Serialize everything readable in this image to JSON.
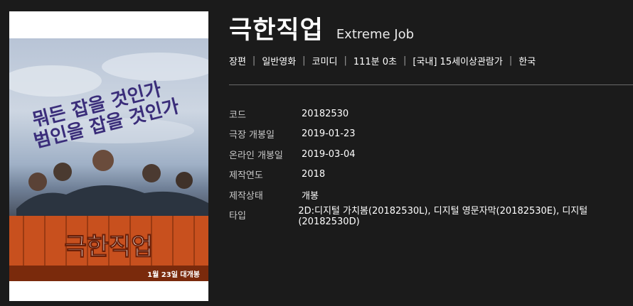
{
  "movie": {
    "title_ko": "극한직업",
    "title_en": "Extreme Job",
    "meta": [
      "장편",
      "일반영화",
      "코미디",
      "111분 0초",
      "[국내] 15세이상관람가",
      "한국"
    ],
    "details": [
      {
        "label": "코드",
        "value": "20182530"
      },
      {
        "label": "극장 개봉일",
        "value": "2019-01-23"
      },
      {
        "label": "온라인 개봉일",
        "value": "2019-03-04"
      },
      {
        "label": "제작연도",
        "value": "2018"
      },
      {
        "label": "제작상태",
        "value": "개봉"
      },
      {
        "label": "타입",
        "value": "2D:디지털 가치봄(20182530L), 디지털 영문자막(20182530E), 디지털(20182530D)"
      }
    ]
  },
  "poster": {
    "tagline_line1": "뭐든 잡을 것인가",
    "tagline_line2": "범인을 잡을 것인가",
    "logo_text": "극한직업",
    "release_text": "1월 23일 대개봉"
  },
  "colors": {
    "background": "#1b1b1b",
    "accent_purple": "#3a2d7a",
    "container_orange": "#c8501e"
  }
}
